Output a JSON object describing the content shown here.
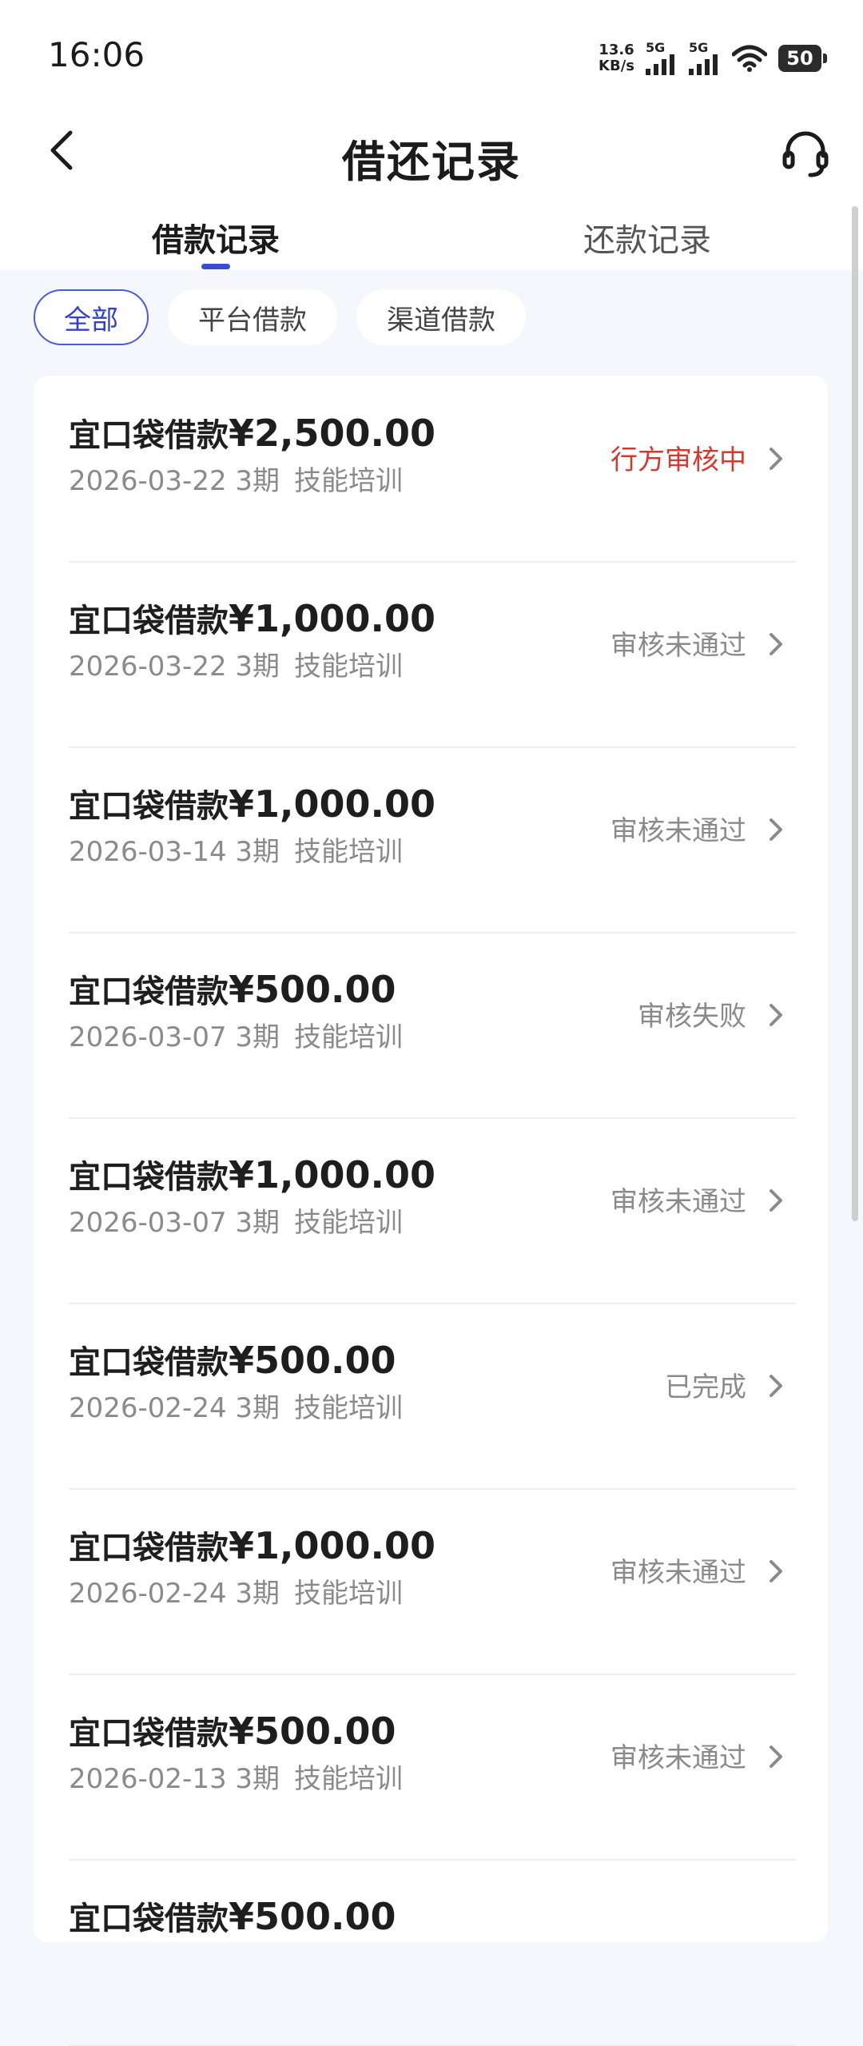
{
  "status_bar": {
    "time": "16:06",
    "net_speed_value": "13.6",
    "net_speed_unit": "KB/s",
    "sim1": "5G",
    "sim2": "5G",
    "battery": "50"
  },
  "header": {
    "title": "借还记录",
    "back_icon": "chevron-left-icon",
    "service_icon": "headset-icon"
  },
  "tabs": [
    {
      "label": "借款记录",
      "active": true
    },
    {
      "label": "还款记录",
      "active": false
    }
  ],
  "filters": [
    {
      "label": "全部",
      "active": true
    },
    {
      "label": "平台借款",
      "active": false
    },
    {
      "label": "渠道借款",
      "active": false
    }
  ],
  "colors": {
    "accent": "#3a4bd6",
    "status_red": "#d23a30",
    "status_gray": "#8a8a8a",
    "background": "#f5f7fc"
  },
  "records": [
    {
      "name": "宜口袋借款",
      "amount": "¥2,500.00",
      "date": "2026-03-22",
      "term": "3期",
      "purpose": "技能培训",
      "status": "行方审核中"
    },
    {
      "name": "宜口袋借款",
      "amount": "¥1,000.00",
      "date": "2026-03-22",
      "term": "3期",
      "purpose": "技能培训",
      "status": "审核未通过"
    },
    {
      "name": "宜口袋借款",
      "amount": "¥1,000.00",
      "date": "2026-03-14",
      "term": "3期",
      "purpose": "技能培训",
      "status": "审核未通过"
    },
    {
      "name": "宜口袋借款",
      "amount": "¥500.00",
      "date": "2026-03-07",
      "term": "3期",
      "purpose": "技能培训",
      "status": "审核失败"
    },
    {
      "name": "宜口袋借款",
      "amount": "¥1,000.00",
      "date": "2026-03-07",
      "term": "3期",
      "purpose": "技能培训",
      "status": "审核未通过"
    },
    {
      "name": "宜口袋借款",
      "amount": "¥500.00",
      "date": "2026-02-24",
      "term": "3期",
      "purpose": "技能培训",
      "status": "已完成"
    },
    {
      "name": "宜口袋借款",
      "amount": "¥1,000.00",
      "date": "2026-02-24",
      "term": "3期",
      "purpose": "技能培训",
      "status": "审核未通过"
    },
    {
      "name": "宜口袋借款",
      "amount": "¥500.00",
      "date": "2026-02-13",
      "term": "3期",
      "purpose": "技能培训",
      "status": "审核未通过"
    },
    {
      "name": "宜口袋借款",
      "amount": "¥500.00",
      "date": "",
      "term": "",
      "purpose": "",
      "status": ""
    }
  ]
}
